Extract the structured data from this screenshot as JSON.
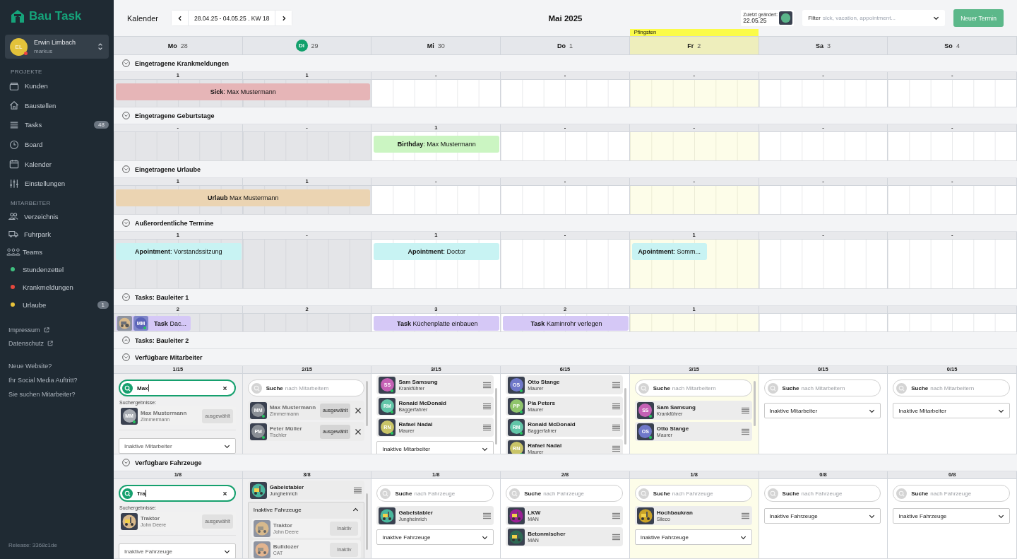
{
  "sidebar": {
    "brand": "Bau Task",
    "user": {
      "initials": "EL",
      "name": "Erwin Limbach",
      "login": "markus",
      "color": "#e3c23a",
      "online": false
    },
    "groups": [
      {
        "title": "PROJEKTE",
        "items": [
          {
            "kind": "icon",
            "label": "Kunden"
          },
          {
            "kind": "icon",
            "label": "Baustellen"
          },
          {
            "kind": "icon",
            "label": "Tasks",
            "badge": "48"
          },
          {
            "kind": "icon",
            "label": "Board"
          },
          {
            "kind": "icon",
            "label": "Kalender"
          },
          {
            "kind": "icon",
            "label": "Einstellungen"
          }
        ]
      },
      {
        "title": "MITARBEITER",
        "items": [
          {
            "kind": "icon",
            "label": "Verzeichnis"
          },
          {
            "kind": "icon",
            "label": "Fuhrpark"
          },
          {
            "kind": "icon",
            "label": "Teams"
          },
          {
            "kind": "dot",
            "label": "Stundenzettel",
            "color": "#3fbf7f"
          },
          {
            "kind": "dot",
            "label": "Krankmeldungen",
            "color": "#e5483d"
          },
          {
            "kind": "dot",
            "label": "Urlaube",
            "color": "#e8c33a",
            "badge": "1"
          }
        ]
      }
    ],
    "links": [
      "Impressum",
      "Datenschutz"
    ],
    "promos": [
      "Neue Website?",
      "Ihr Social Media Auftritt?",
      "Sie suchen Mitarbeiter?"
    ],
    "release": "Release: 3368c1de"
  },
  "toolbar": {
    "title": "Kalender",
    "range": "28.04.25 - 04.05.25 . KW 18",
    "month": "Mai 2025",
    "last_changed": {
      "label": "Zuletzt geändert:",
      "date": "22.05.25"
    },
    "filter": {
      "label": "Filter",
      "placeholder": "sick, vacation, appointment..."
    },
    "new_button": "Neuer Termin"
  },
  "days": [
    {
      "name": "Mo",
      "date": "28",
      "past": true,
      "today": false
    },
    {
      "name": "Di",
      "date": "29",
      "past": true,
      "today": true
    },
    {
      "name": "Mi",
      "date": "30",
      "past": false,
      "today": false
    },
    {
      "name": "Do",
      "date": "1",
      "past": false,
      "today": false
    },
    {
      "name": "Fr",
      "date": "2",
      "past": false,
      "today": false,
      "holiday": "Pfingsten"
    },
    {
      "name": "Sa",
      "date": "3",
      "past": false,
      "today": false
    },
    {
      "name": "So",
      "date": "4",
      "past": false,
      "today": false
    }
  ],
  "sections": [
    {
      "kind": "events",
      "title": "Eingetragene Krankmeldungen",
      "expanded": true,
      "cells": [
        {
          "count": "1",
          "events": [
            {
              "kind": "sick",
              "text": "**Sick**: Max Mustermann",
              "continues": true,
              "compact": false
            }
          ]
        },
        {
          "count": "1"
        },
        {
          "count": "-"
        },
        {
          "count": "-"
        },
        {
          "count": "-"
        },
        {
          "count": "-"
        },
        {
          "count": "-"
        }
      ]
    },
    {
      "kind": "events",
      "title": "Eingetragene Geburtstage",
      "expanded": true,
      "cells": [
        {
          "count": "-"
        },
        {
          "count": "-"
        },
        {
          "count": "1",
          "events": [
            {
              "kind": "birthday",
              "text": "**Birthday**: Max Mustermann",
              "continues": false,
              "compact": false
            }
          ]
        },
        {
          "count": "-"
        },
        {
          "count": "-"
        },
        {
          "count": "-"
        },
        {
          "count": "-"
        }
      ]
    },
    {
      "kind": "events",
      "title": "Eingetragene Urlaube",
      "expanded": true,
      "cells": [
        {
          "count": "1",
          "events": [
            {
              "kind": "vacation",
              "text": "**Urlaub** Max Mustermann",
              "continues": true,
              "compact": false
            }
          ]
        },
        {
          "count": "1"
        },
        {
          "count": "-"
        },
        {
          "count": "-"
        },
        {
          "count": "-"
        },
        {
          "count": "-"
        },
        {
          "count": "-"
        }
      ]
    },
    {
      "kind": "events",
      "title": "Außerordentliche Termine",
      "expanded": true,
      "cells": [
        {
          "count": "1",
          "events": [
            {
              "kind": "appointment",
              "text": "**Apointment**: Vorstandssitzung",
              "continues": false,
              "compact": false
            }
          ]
        },
        {
          "count": "-"
        },
        {
          "count": "1",
          "events": [
            {
              "kind": "appointment",
              "text": "**Apointment**: Doctor",
              "continues": false,
              "compact": false
            }
          ]
        },
        {
          "count": "-"
        },
        {
          "count": "1",
          "events": [
            {
              "kind": "appointment",
              "text": "**Apointment**: Somm...",
              "continues": false,
              "compact": true
            }
          ]
        },
        {
          "count": "-"
        },
        {
          "count": "-"
        }
      ]
    },
    {
      "kind": "events",
      "title": "Tasks: Bauleiter 1",
      "expanded": true,
      "cells": [
        {
          "count": "2",
          "events": [
            {
              "kind": "task",
              "text": "**Task** Dac...",
              "continues": false,
              "compact": true,
              "avatars": [
                {
                  "kind": "vehicle",
                  "color": "#d8b98c"
                },
                {
                  "kind": "person",
                  "initials": "MM",
                  "color": "#5b63b8",
                  "online": true
                }
              ]
            }
          ]
        },
        {
          "count": "2"
        },
        {
          "count": "3",
          "events": [
            {
              "kind": "task",
              "text": "**Task** Küchenplatte einbauen",
              "continues": false,
              "compact": false
            }
          ]
        },
        {
          "count": "2",
          "events": [
            {
              "kind": "task",
              "text": "**Task** Kaminrohr verlegen",
              "continues": false,
              "compact": false
            }
          ]
        },
        {
          "count": "1"
        },
        {},
        {}
      ]
    },
    {
      "title": "Tasks: Bauleiter 2",
      "expanded": false
    },
    {
      "kind": "people",
      "title": "Verfügbare Mitarbeiter",
      "expanded": true,
      "cells": [
        {
          "count": "**1**/15",
          "search": {
            "value": "Max"
          },
          "results_label": "Suchergebnisse:",
          "cards": [
            {
              "kind": "result",
              "name": "Max Mustermann",
              "role": "Zimmermann",
              "initials": "MM",
              "color": "#a8acb3",
              "online": true,
              "button": "ausgewählt"
            }
          ],
          "inactive": {
            "label": "Inaktive Mitarbeiter",
            "expanded": false
          }
        },
        {
          "count": "**2**/15",
          "search": {
            "label": "Suche",
            "placeholder": "nach Mitarbeitern"
          },
          "scrollable": true,
          "cards": [
            {
              "kind": "assigned",
              "name": "Max Mustermann",
              "role": "Zimmermann",
              "initials": "MM",
              "color": "#8a8f96",
              "online": true,
              "button": "ausgewählt"
            },
            {
              "kind": "assigned",
              "name": "Peter Müller",
              "role": "Tischler",
              "initials": "PM",
              "color": "#8a8f96",
              "online": true,
              "button": "ausgewählt"
            }
          ]
        },
        {
          "count": "**3**/15",
          "scrollable": true,
          "scrolled": true,
          "cards": [
            {
              "kind": "member",
              "name": "Sam Samsung",
              "role": "Krankführer",
              "initials": "SS",
              "color": "#c561b5",
              "online": true
            },
            {
              "kind": "member",
              "name": "Ronald McDonald",
              "role": "Baggerfahrer",
              "initials": "RM",
              "color": "#62c5a8",
              "online": true
            },
            {
              "kind": "member",
              "name": "Rafael Nadal",
              "role": "Maurer",
              "initials": "RN",
              "color": "#c9c468",
              "online": true
            }
          ],
          "inactive": {
            "label": "Inaktive Mitarbeiter",
            "expanded": false
          }
        },
        {
          "count": "**6**/15",
          "scrollable": true,
          "scrolled": true,
          "cards": [
            {
              "kind": "member",
              "name": "Otto Stange",
              "role": "Maurer",
              "initials": "OS",
              "color": "#6f78c9",
              "online": true
            },
            {
              "kind": "member",
              "name": "Pia Peters",
              "role": "Maurer",
              "initials": "PP",
              "color": "#8fc46b",
              "online": true
            },
            {
              "kind": "member",
              "name": "Ronald McDonald",
              "role": "Baggerfahrer",
              "initials": "RM",
              "color": "#62c5a8",
              "online": true
            },
            {
              "kind": "member",
              "name": "Rafael Nadal",
              "role": "Maurer",
              "initials": "RN",
              "color": "#c9c468",
              "online": true
            }
          ]
        },
        {
          "count": "**3**/15",
          "search": {
            "label": "Suche",
            "placeholder": "nach Mitarbeitern"
          },
          "scrollable": true,
          "cards": [
            {
              "kind": "member",
              "name": "Sam Samsung",
              "role": "Krankführer",
              "initials": "SS",
              "color": "#c561b5",
              "online": true
            },
            {
              "kind": "member",
              "name": "Otto Stange",
              "role": "Maurer",
              "initials": "OS",
              "color": "#6f78c9",
              "online": true
            }
          ]
        },
        {
          "count": "**0**/15",
          "search": {
            "label": "Suche",
            "placeholder": "nach Mitarbeitern"
          },
          "inactive": {
            "label": "Inaktive Mitarbeiter",
            "expanded": false
          }
        },
        {
          "count": "**0**/15",
          "search": {
            "label": "Suche",
            "placeholder": "nach Mitarbeitern"
          },
          "inactive": {
            "label": "Inaktive Mitarbeiter",
            "expanded": false
          }
        }
      ]
    },
    {
      "kind": "vehicles",
      "title": "Verfügbare Fahrzeuge",
      "expanded": true,
      "cells": [
        {
          "count": "**1**/8",
          "search": {
            "value": "Tra"
          },
          "results_label": "Suchergebnisse:",
          "cards": [
            {
              "kind": "result",
              "name": "Traktor",
              "role": "John Deere",
              "color": "#d8b98c",
              "button": "ausgewählt"
            }
          ],
          "inactive": {
            "label": "Inaktive Fahrzeuge",
            "expanded": false
          }
        },
        {
          "count": "**3**/8",
          "scrollable": true,
          "scrolled": true,
          "cards": [
            {
              "kind": "member",
              "name": "Gabelstabler",
              "role": "Jungheinrich",
              "color": "#49b69c"
            }
          ],
          "inactive": {
            "label": "Inaktive Fahrzeuge",
            "expanded": true,
            "cards": [
              {
                "kind": "inactive",
                "name": "Traktor",
                "role": "John Deere",
                "color": "#d8b98c",
                "button": "Inaktiv"
              },
              {
                "kind": "inactive",
                "name": "Bulldozer",
                "role": "CAT",
                "color": "#e2b48f",
                "button": "Inaktiv"
              }
            ]
          }
        },
        {
          "count": "**1**/8",
          "search": {
            "label": "Suche",
            "placeholder": "nach Fahrzeuge"
          },
          "cards": [
            {
              "kind": "member",
              "name": "Gabelstabler",
              "role": "Jungheinrich",
              "color": "#49b69c"
            }
          ],
          "inactive": {
            "label": "Inaktive Fahrzeuge",
            "expanded": false
          }
        },
        {
          "count": "**2**/8",
          "search": {
            "label": "Suche",
            "placeholder": "nach Fahrzeuge"
          },
          "cards": [
            {
              "kind": "member",
              "name": "LKW",
              "role": "MAN",
              "color": "#9a1f94"
            },
            {
              "kind": "member",
              "name": "Betonmischer",
              "role": "MAN",
              "color": "#2e6a54"
            }
          ]
        },
        {
          "count": "**1**/8",
          "search": {
            "label": "Suche",
            "placeholder": "nach Fahrzeuge"
          },
          "cards": [
            {
              "kind": "member",
              "name": "Hochbaukran",
              "role": "Sileco",
              "color": "#c9a227"
            }
          ],
          "inactive": {
            "label": "Inaktive Fahrzeuge",
            "expanded": false
          }
        },
        {
          "count": "**0**/8",
          "search": {
            "label": "Suche",
            "placeholder": "nach Fahrzeuge"
          },
          "inactive": {
            "label": "Inaktive Fahrzeuge",
            "expanded": false
          }
        },
        {
          "count": "**0**/8",
          "search": {
            "label": "Suche",
            "placeholder": "nach Fahrzeuge"
          },
          "inactive": {
            "label": "Inaktive Fahrzeuge",
            "expanded": false
          }
        }
      ]
    }
  ]
}
